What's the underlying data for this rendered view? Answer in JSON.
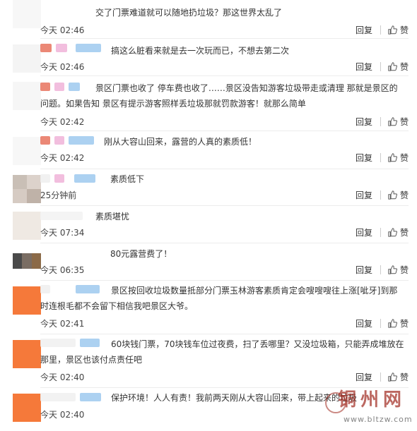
{
  "labels": {
    "reply": "回复",
    "like": "赞"
  },
  "comments": [
    {
      "text": "交了门票难道就可以随地扔垃圾？那这世界太乱了",
      "time": "今天 02:46"
    },
    {
      "text": "搞这么脏看来就是去一次玩而已，不想去第二次",
      "time": "今天 02:46"
    },
    {
      "text": "景区门票也收了 停车费也收了……景区没告知游客垃圾带走或清理 那就是景区的问题。如果告知 景区有提示游客照样丢垃圾那就罚款游客！就那么简单",
      "time": "今天 02:42"
    },
    {
      "text": "刚从大容山回来，露营的人真的素质低！",
      "time": "今天 02:42"
    },
    {
      "text": "素质低下",
      "time": "25分钟前"
    },
    {
      "text": "素质堪忧",
      "time": "今天 07:34"
    },
    {
      "text": "80元露营费了！",
      "time": "今天 06:35"
    },
    {
      "text": "景区按回收垃圾数量抵部分门票玉林游客素质肯定会嗖嗖嗖往上涨[呲牙]到那时连根毛都不会留下相信我吧景区大爷。",
      "time": "今天 02:41"
    },
    {
      "text": "60块钱门票，70块钱车位过夜费，扫了丢哪里？又没垃圾箱，只能弄成堆放在那里，景区也该付点责任吧",
      "time": "今天 02:40"
    },
    {
      "text": "保护环境！人人有责！我前两天刚从大容山回来，带上起来的垃圾",
      "time": "今天 02:40"
    }
  ],
  "watermark": {
    "title": "铜州网",
    "url": "www.bltzw.com"
  }
}
